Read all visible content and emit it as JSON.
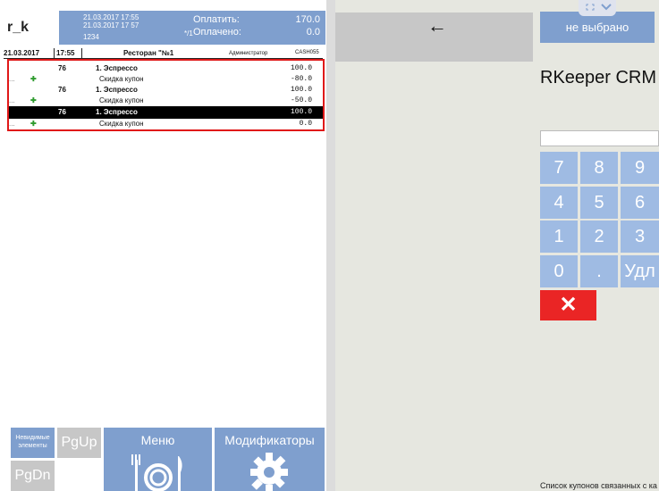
{
  "header": {
    "logo": "r_k",
    "datetime_open": "21.03.2017 17:55",
    "datetime_now": "21.03.2017 17 57",
    "table_code": "1234",
    "seat": "*/1",
    "pay_label": "Оплатить:",
    "pay_value": "170.0",
    "paid_label": "Оплачено:",
    "paid_value": "0.0"
  },
  "info": {
    "date": "21.03.2017",
    "time": "17:55",
    "restaurant": "Ресторан \"№1",
    "role": "Администратор",
    "cashier": "CASH055"
  },
  "order_lines": [
    {
      "qty": "76",
      "item": "1.  Эспрессо",
      "price": "100.0",
      "discount_label": "Скидка купон",
      "discount_value": "-80.0"
    },
    {
      "qty": "76",
      "item": "1.  Эспрессо",
      "price": "100.0",
      "discount_label": "Скидка купон",
      "discount_value": "-50.0"
    },
    {
      "qty": "76",
      "item": "1.  Эспрессо",
      "price": "100.0",
      "discount_label": "Скидка купон",
      "discount_value": "0.0"
    }
  ],
  "order_markers": {
    "dots": "...",
    "plus": "✚"
  },
  "buttons": {
    "invisible": "Невидимые элементы",
    "pgup": "PgUp",
    "pgdn": "PgDn",
    "menu": "Меню",
    "modifiers": "Модификаторы",
    "back_arrow": "←",
    "not_selected": "не выбрано",
    "delete": "✕"
  },
  "right": {
    "title": "RKeeper CRM",
    "input_value": "",
    "status": "Список купонов связанных с ка"
  },
  "keypad": [
    "7",
    "8",
    "9",
    "4",
    "5",
    "6",
    "1",
    "2",
    "3",
    "0",
    ".",
    "Удл"
  ],
  "icons": {
    "menu": "plate-cutlery-icon",
    "modifiers": "gear-icon",
    "back": "arrow-left-icon",
    "collapse": "chevron-down-icon"
  },
  "colors": {
    "blue_button": "#7f9fce",
    "key_button": "#9fbbe3",
    "delete": "#ea2525",
    "order_border": "#e01818",
    "selected_row": "#000000"
  }
}
